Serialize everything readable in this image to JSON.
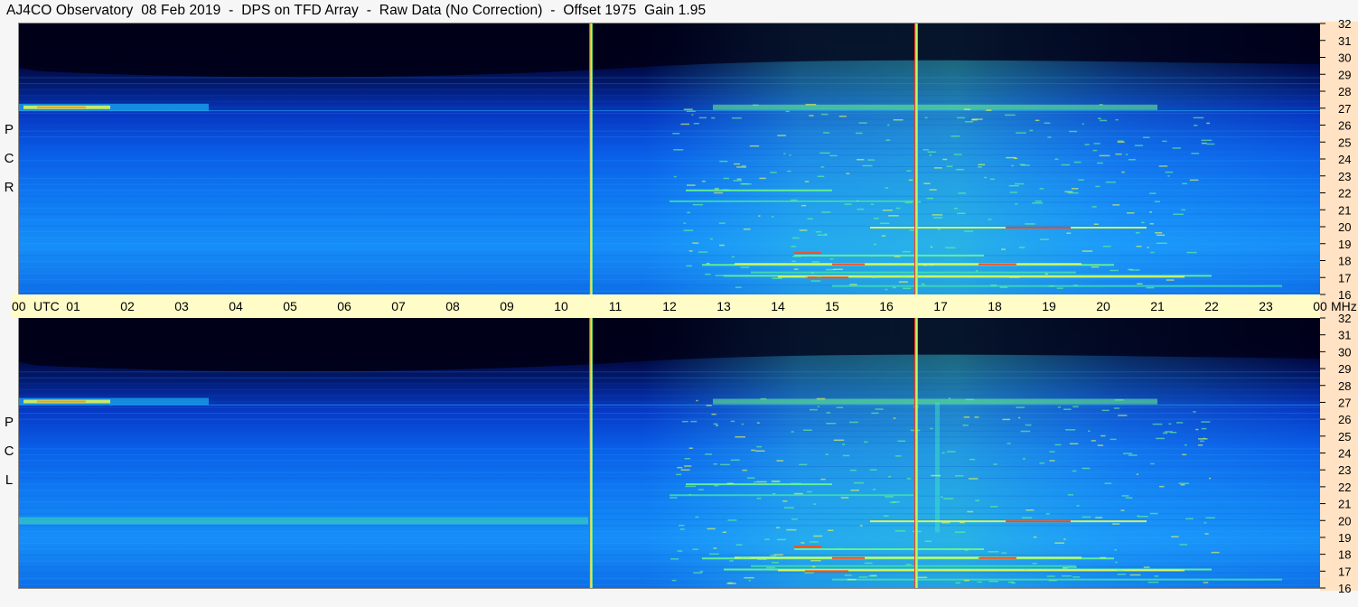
{
  "title": "AJ4CO Observatory  08 Feb 2019  -  DPS on TFD Array  -  Raw Data (No Correction)  -  Offset 1975  Gain 1.95",
  "panels": [
    {
      "id": "rcp",
      "polarization_letters": [
        "R",
        "C",
        "P"
      ]
    },
    {
      "id": "lcp",
      "polarization_letters": [
        "L",
        "C",
        "P"
      ]
    }
  ],
  "colors": {
    "background": "#f6f6f6",
    "time_axis_band": "#fffcc8",
    "freq_axis_band": "#ffe3c4",
    "sky_dark": "#00001e",
    "sky_mid": "#0a5de8",
    "sky_bright": "#1aa6ff",
    "interference_green": "#6dfc8a",
    "interference_yellow": "#f3ff4c",
    "interference_red": "#ff4a20"
  },
  "chart_data": {
    "type": "heatmap",
    "title": "AJ4CO Observatory  08 Feb 2019  -  DPS on TFD Array  -  Raw Data (No Correction)  -  Offset 1975  Gain 1.95",
    "x_axis": {
      "unit_label": "UTC",
      "tick_labels": [
        "00",
        "01",
        "02",
        "03",
        "04",
        "05",
        "06",
        "07",
        "08",
        "09",
        "10",
        "11",
        "12",
        "13",
        "14",
        "15",
        "16",
        "17",
        "18",
        "19",
        "20",
        "21",
        "22",
        "23",
        "00"
      ],
      "range_hours": [
        0,
        24
      ]
    },
    "y_axis": {
      "unit_label": "MHz",
      "tick_labels": [
        "32",
        "31",
        "30",
        "29",
        "28",
        "27",
        "26",
        "25",
        "24",
        "23",
        "22",
        "21",
        "20",
        "19",
        "18",
        "17",
        "16"
      ],
      "range_mhz": [
        16,
        32
      ]
    },
    "panels": [
      "RCP",
      "LCP"
    ],
    "vertical_markers_utc_hours": [
      10.55,
      16.55
    ],
    "grid": false,
    "legend": "none"
  }
}
